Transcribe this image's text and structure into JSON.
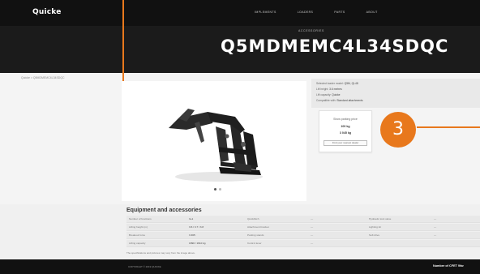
{
  "nav": {
    "logo": "Quicke",
    "links": [
      "Implements",
      "Loaders",
      "Parts",
      "About"
    ]
  },
  "hero": {
    "kicker": "Accessories",
    "title": "Q5MDMEMC4L34SDQC"
  },
  "breadcrumb": "Quicke > Q5MDMEMC4L34SDQC",
  "specs": [
    {
      "label": "Selected loader model:",
      "value": "Q5M, QL48"
    },
    {
      "label": "Lift height:",
      "value": "3.6 metres"
    },
    {
      "label": "Lift capacity:",
      "value": "Quicke"
    },
    {
      "label": "Compatible with:",
      "value": "Standard attachments"
    }
  ],
  "price_card": {
    "label": "Show parking price",
    "value1": "100 kg",
    "value2": "3 045 kg",
    "button": "Find your nearest dealer"
  },
  "annotation": {
    "number": "3"
  },
  "equipment": {
    "title": "Equipment and accessories",
    "rows": [
      [
        "Number of functions",
        "3+1",
        "Quickhitch",
        "—",
        "Hydraulic lock valve",
        "—"
      ],
      [
        "Lifting height (m)",
        "3.6 / 3.7 / 3.8",
        "Attachment bracket",
        "—",
        "Lighting kit",
        "—"
      ],
      [
        "Breakout force",
        "3 465",
        "Parking stands",
        "—",
        "Soft drive",
        "—"
      ],
      [
        "Lifting capacity",
        "1890 / 1610 kg",
        "Control lever",
        "—",
        "",
        ""
      ]
    ],
    "note": "The specifications and pictures may vary from the image above."
  },
  "footer": {
    "left": "Copyright © 2019 Quicke",
    "right": "Number of CFET Ww"
  },
  "product_image": {
    "label": "front-loader-image"
  },
  "colors": {
    "accent": "#e8781c",
    "nav_bg": "#111111",
    "hero_bg": "#1b1b1b"
  }
}
